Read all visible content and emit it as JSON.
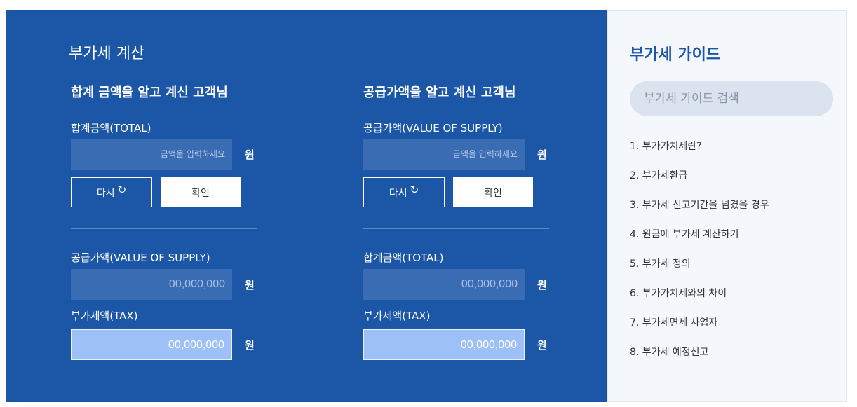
{
  "calculator": {
    "title": "부가세 계산",
    "total_known": {
      "heading": "합계 금액을 알고 계신 고객님",
      "input_label": "합계금액(TOTAL)",
      "input_placeholder": "금액을 입력하세요",
      "unit": "원",
      "reset_label": "다시",
      "reset_icon": "refresh-icon",
      "confirm_label": "확인",
      "out1_label": "공급가액(VALUE OF SUPPLY)",
      "out1_value": "00,000,000",
      "out2_label": "부가세액(TAX)",
      "out2_value": "00,000,000"
    },
    "supply_known": {
      "heading": "공급가액을 알고 계신 고객님",
      "input_label": "공급가액(VALUE OF SUPPLY)",
      "input_placeholder": "금액을 입력하세요",
      "unit": "원",
      "reset_label": "다시",
      "reset_icon": "refresh-icon",
      "confirm_label": "확인",
      "out1_label": "합계금액(TOTAL)",
      "out1_value": "00,000,000",
      "out2_label": "부가세액(TAX)",
      "out2_value": "00,000,000"
    }
  },
  "guide": {
    "title": "부가세 가이드",
    "search_placeholder": "부가세 가이드 검색",
    "items": [
      "1. 부가가치세란?",
      "2. 부가세환급",
      "3. 부가세 신고기간을 넘겼을 경우",
      "4. 원금에 부가세 계산하기",
      "5. 부가세 정의",
      "6. 부가가치세와의 차이",
      "7. 부가세면세 사업자",
      "8. 부가세 예정신고"
    ]
  },
  "colors": {
    "panel_blue": "#1c56a6",
    "input_blue": "#3a6cb4",
    "tax_highlight": "#9dc1f6",
    "guide_bg": "#f4f7fc"
  }
}
